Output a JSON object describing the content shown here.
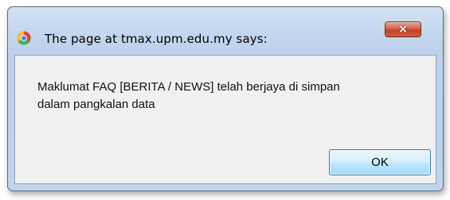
{
  "dialog": {
    "title": "The page at tmax.upm.edu.my says:",
    "close_glyph": "×",
    "message_lines": [
      "Maklumat FAQ [BERITA  / NEWS] telah berjaya di simpan",
      "dalam pangkalan data"
    ],
    "ok_label": "OK",
    "title_icon": "chrome-icon",
    "close_icon": "close-icon"
  },
  "colors": {
    "frame": "#c4d7ee",
    "client": "#f0f0f0",
    "close_button": "#c1402a",
    "ok_button": "#bee6fd"
  }
}
